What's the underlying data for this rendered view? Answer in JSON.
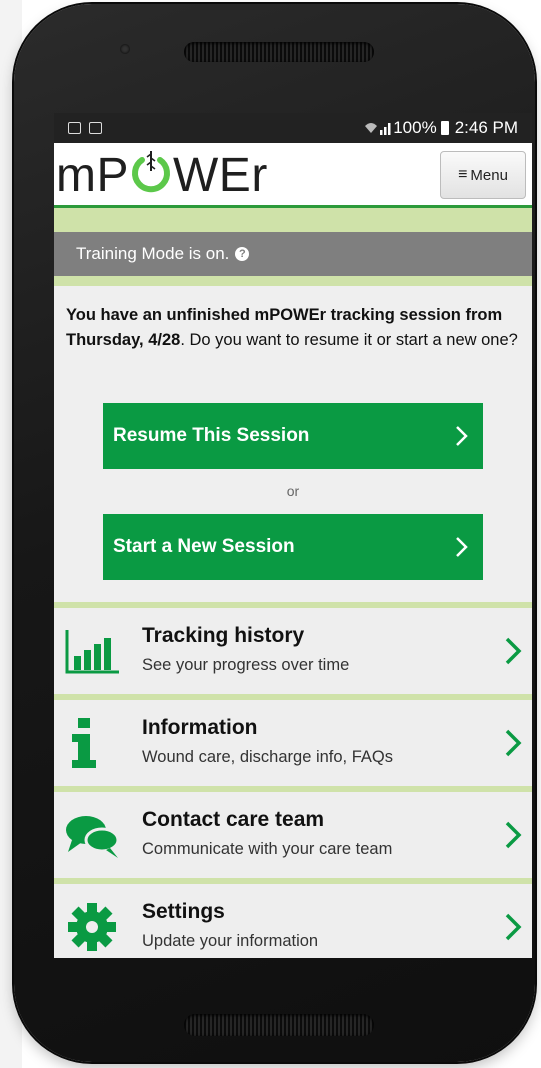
{
  "status_bar": {
    "battery": "100%",
    "time": "2:46 PM"
  },
  "app": {
    "logo_text_left": "mP",
    "logo_text_right": "WEr",
    "menu_label": "Menu"
  },
  "training_mode": {
    "text": "Training Mode is on."
  },
  "session_prompt": {
    "bold_text": "You have an unfinished mPOWEr tracking session from Thursday, 4/28",
    "rest_text": ". Do you want to resume it or start a new one?"
  },
  "buttons": {
    "resume": "Resume This Session",
    "or": "or",
    "new_session": "Start a New Session"
  },
  "nav": {
    "items": [
      {
        "title": "Tracking history",
        "subtitle": "See your progress over time",
        "icon": "bar-chart-icon"
      },
      {
        "title": "Information",
        "subtitle": "Wound care, discharge info, FAQs",
        "icon": "info-icon"
      },
      {
        "title": "Contact care team",
        "subtitle": "Communicate with your care team",
        "icon": "chat-bubbles-icon"
      },
      {
        "title": "Settings",
        "subtitle": "Update your information",
        "icon": "gear-icon"
      }
    ]
  },
  "colors": {
    "brand_green": "#0a9a43",
    "band_green": "#cfe2a9",
    "training_gray": "#7f7f7f"
  }
}
